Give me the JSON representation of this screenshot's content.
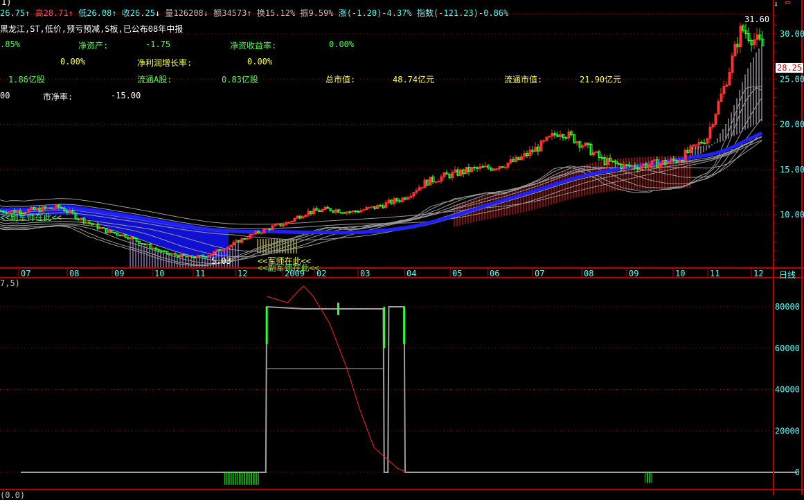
{
  "window": {
    "title_fragment": "1)"
  },
  "quote": {
    "open": "26.75",
    "high_label": "高",
    "high": "28.71",
    "low_label": "低",
    "low": "26.08",
    "close_label": "收",
    "close": "26.25",
    "volume": "量126208",
    "amount": "额34573",
    "turnover": "换15.12%",
    "amplitude": "振9.59%",
    "change": "涨(-1.20)-4.37%",
    "index": "指数(-121.23)-0.86%"
  },
  "stock_tags": "黑龙江,ST,低价,预亏预减,S板,已公布08年中报",
  "fundamentals": {
    "row1": {
      "v0": ".85%",
      "l1": "净资产:",
      "v1": "-1.75",
      "l2": "净资收益率:",
      "v2": "0.00%"
    },
    "row2": {
      "v0": "0.00%",
      "l1": "净利润增长率:",
      "v1": "0.00%"
    },
    "row3": {
      "v0": "1.86亿股",
      "l1": "流通A股:",
      "v1": "0.83亿股",
      "l2": "总市值:",
      "v2": "48.74亿元",
      "l3": "流通市值:",
      "v3": "21.90亿元"
    },
    "row4": {
      "v0": "00",
      "l1": "市净率:",
      "v1": "-15.00"
    }
  },
  "annotations": {
    "high_marker": "31.60",
    "low_marker": "5.03",
    "signal1": "<<军师在此<<",
    "signal2": "<<副军师在此<<",
    "current_price": "28.25"
  },
  "period_label": "日线",
  "indicator_title": "7,5)",
  "bottom_fragment": "(0.0)",
  "chart_data": [
    {
      "type": "candlestick",
      "title": "Daily K-line",
      "x_tick_labels": [
        "07",
        "08",
        "09",
        "10",
        "11",
        "12",
        "2009",
        "02",
        "03",
        "04",
        "05",
        "06",
        "07",
        "08",
        "09",
        "10",
        "11",
        "12"
      ],
      "y_tick_labels": [
        "30.00",
        "25.00",
        "20.00",
        "15.00",
        "10.00"
      ],
      "ylim": [
        3.5,
        32.5
      ],
      "close_path": [
        [
          0,
          10.4
        ],
        [
          0.8,
          10.8
        ],
        [
          1.2,
          9.6
        ],
        [
          1.8,
          8.2
        ],
        [
          2.3,
          7.6
        ],
        [
          2.8,
          6.6
        ],
        [
          3.2,
          5.8
        ],
        [
          3.8,
          5.3
        ],
        [
          4.2,
          5.4
        ],
        [
          4.8,
          6.6
        ],
        [
          5.3,
          7.8
        ],
        [
          5.7,
          8.6
        ],
        [
          6.1,
          9.2
        ],
        [
          6.6,
          10.2
        ],
        [
          7.3,
          10.6
        ],
        [
          7.8,
          10.3
        ],
        [
          8.3,
          10.8
        ],
        [
          8.9,
          11.8
        ],
        [
          9.4,
          13.6
        ],
        [
          9.9,
          14.4
        ],
        [
          10.5,
          15.0
        ],
        [
          11.0,
          15.2
        ],
        [
          11.6,
          16.0
        ],
        [
          12.1,
          17.6
        ],
        [
          12.5,
          19.3
        ],
        [
          12.9,
          18.0
        ],
        [
          13.4,
          16.0
        ],
        [
          13.9,
          15.3
        ],
        [
          14.5,
          15.6
        ],
        [
          15.0,
          16.0
        ],
        [
          15.5,
          17.3
        ],
        [
          15.9,
          18.6
        ],
        [
          16.3,
          24.0
        ],
        [
          16.7,
          30.6
        ],
        [
          17.1,
          29.0
        ],
        [
          17.4,
          28.0
        ],
        [
          18.0,
          26.25
        ]
      ],
      "current_price": 26.25,
      "high": 31.6,
      "low": 5.03
    },
    {
      "type": "line",
      "title": "Indicator (7,5)",
      "y_tick_labels": [
        "80000",
        "60000",
        "40000",
        "20000",
        "0"
      ],
      "ylim": [
        -8000,
        92000
      ],
      "series": [
        {
          "name": "grey-main",
          "color": "#a0a0a0",
          "points": [
            [
              0,
              0
            ],
            [
              5.6,
              0
            ],
            [
              5.62,
              80000
            ],
            [
              6.6,
              79000
            ],
            [
              8.5,
              79000
            ],
            [
              8.52,
              0
            ],
            [
              8.6,
              0
            ],
            [
              8.62,
              80000
            ],
            [
              8.95,
              80000
            ],
            [
              8.97,
              0
            ],
            [
              18,
              0
            ]
          ]
        },
        {
          "name": "grey-mid",
          "color": "#a0a0a0",
          "points": [
            [
              5.62,
              50000
            ],
            [
              6.6,
              50000
            ],
            [
              8.5,
              50000
            ]
          ]
        },
        {
          "name": "red-curve",
          "color": "#ff2020",
          "points": [
            [
              5.62,
              85000
            ],
            [
              6.1,
              82000
            ],
            [
              6.45,
              88000
            ],
            [
              6.6,
              90000
            ],
            [
              6.9,
              85000
            ],
            [
              7.3,
              72000
            ],
            [
              7.7,
              50000
            ],
            [
              8.0,
              30000
            ],
            [
              8.3,
              12000
            ],
            [
              8.6,
              6000
            ],
            [
              8.8,
              2000
            ],
            [
              9.0,
              0
            ]
          ]
        }
      ],
      "bars": {
        "color": "#00ff00",
        "points": [
          [
            4.7,
            -6000
          ],
          [
            4.75,
            -6000
          ],
          [
            4.8,
            -6000
          ],
          [
            4.85,
            -6000
          ],
          [
            4.9,
            -6000
          ],
          [
            4.95,
            -6000
          ],
          [
            5.0,
            -6000
          ],
          [
            5.05,
            -6000
          ],
          [
            5.1,
            -6000
          ],
          [
            5.15,
            -6000
          ],
          [
            5.2,
            -6000
          ],
          [
            5.25,
            -6000
          ],
          [
            5.3,
            -6000
          ],
          [
            5.35,
            -6000
          ],
          [
            5.4,
            -6000
          ],
          [
            14.35,
            -5000
          ],
          [
            14.4,
            -5000
          ],
          [
            14.45,
            -5000
          ]
        ]
      }
    }
  ],
  "colors": {
    "up": "#ff3030",
    "down": "#30ff30",
    "ma_main": "#2020ff",
    "axis": "#c00000",
    "label": "#54ffff"
  }
}
